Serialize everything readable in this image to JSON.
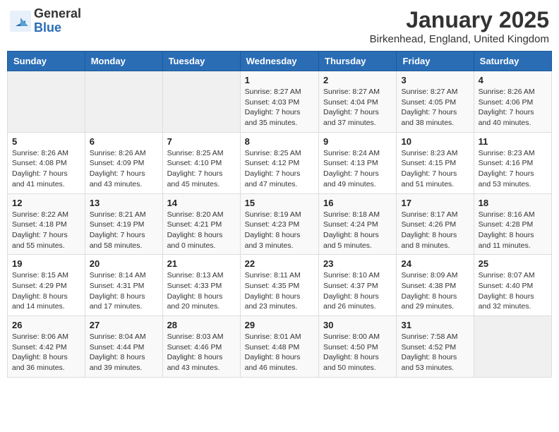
{
  "logo": {
    "general": "General",
    "blue": "Blue"
  },
  "title": "January 2025",
  "location": "Birkenhead, England, United Kingdom",
  "weekdays": [
    "Sunday",
    "Monday",
    "Tuesday",
    "Wednesday",
    "Thursday",
    "Friday",
    "Saturday"
  ],
  "weeks": [
    [
      {
        "day": "",
        "sunrise": "",
        "sunset": "",
        "daylight": ""
      },
      {
        "day": "",
        "sunrise": "",
        "sunset": "",
        "daylight": ""
      },
      {
        "day": "",
        "sunrise": "",
        "sunset": "",
        "daylight": ""
      },
      {
        "day": "1",
        "sunrise": "Sunrise: 8:27 AM",
        "sunset": "Sunset: 4:03 PM",
        "daylight": "Daylight: 7 hours and 35 minutes."
      },
      {
        "day": "2",
        "sunrise": "Sunrise: 8:27 AM",
        "sunset": "Sunset: 4:04 PM",
        "daylight": "Daylight: 7 hours and 37 minutes."
      },
      {
        "day": "3",
        "sunrise": "Sunrise: 8:27 AM",
        "sunset": "Sunset: 4:05 PM",
        "daylight": "Daylight: 7 hours and 38 minutes."
      },
      {
        "day": "4",
        "sunrise": "Sunrise: 8:26 AM",
        "sunset": "Sunset: 4:06 PM",
        "daylight": "Daylight: 7 hours and 40 minutes."
      }
    ],
    [
      {
        "day": "5",
        "sunrise": "Sunrise: 8:26 AM",
        "sunset": "Sunset: 4:08 PM",
        "daylight": "Daylight: 7 hours and 41 minutes."
      },
      {
        "day": "6",
        "sunrise": "Sunrise: 8:26 AM",
        "sunset": "Sunset: 4:09 PM",
        "daylight": "Daylight: 7 hours and 43 minutes."
      },
      {
        "day": "7",
        "sunrise": "Sunrise: 8:25 AM",
        "sunset": "Sunset: 4:10 PM",
        "daylight": "Daylight: 7 hours and 45 minutes."
      },
      {
        "day": "8",
        "sunrise": "Sunrise: 8:25 AM",
        "sunset": "Sunset: 4:12 PM",
        "daylight": "Daylight: 7 hours and 47 minutes."
      },
      {
        "day": "9",
        "sunrise": "Sunrise: 8:24 AM",
        "sunset": "Sunset: 4:13 PM",
        "daylight": "Daylight: 7 hours and 49 minutes."
      },
      {
        "day": "10",
        "sunrise": "Sunrise: 8:23 AM",
        "sunset": "Sunset: 4:15 PM",
        "daylight": "Daylight: 7 hours and 51 minutes."
      },
      {
        "day": "11",
        "sunrise": "Sunrise: 8:23 AM",
        "sunset": "Sunset: 4:16 PM",
        "daylight": "Daylight: 7 hours and 53 minutes."
      }
    ],
    [
      {
        "day": "12",
        "sunrise": "Sunrise: 8:22 AM",
        "sunset": "Sunset: 4:18 PM",
        "daylight": "Daylight: 7 hours and 55 minutes."
      },
      {
        "day": "13",
        "sunrise": "Sunrise: 8:21 AM",
        "sunset": "Sunset: 4:19 PM",
        "daylight": "Daylight: 7 hours and 58 minutes."
      },
      {
        "day": "14",
        "sunrise": "Sunrise: 8:20 AM",
        "sunset": "Sunset: 4:21 PM",
        "daylight": "Daylight: 8 hours and 0 minutes."
      },
      {
        "day": "15",
        "sunrise": "Sunrise: 8:19 AM",
        "sunset": "Sunset: 4:23 PM",
        "daylight": "Daylight: 8 hours and 3 minutes."
      },
      {
        "day": "16",
        "sunrise": "Sunrise: 8:18 AM",
        "sunset": "Sunset: 4:24 PM",
        "daylight": "Daylight: 8 hours and 5 minutes."
      },
      {
        "day": "17",
        "sunrise": "Sunrise: 8:17 AM",
        "sunset": "Sunset: 4:26 PM",
        "daylight": "Daylight: 8 hours and 8 minutes."
      },
      {
        "day": "18",
        "sunrise": "Sunrise: 8:16 AM",
        "sunset": "Sunset: 4:28 PM",
        "daylight": "Daylight: 8 hours and 11 minutes."
      }
    ],
    [
      {
        "day": "19",
        "sunrise": "Sunrise: 8:15 AM",
        "sunset": "Sunset: 4:29 PM",
        "daylight": "Daylight: 8 hours and 14 minutes."
      },
      {
        "day": "20",
        "sunrise": "Sunrise: 8:14 AM",
        "sunset": "Sunset: 4:31 PM",
        "daylight": "Daylight: 8 hours and 17 minutes."
      },
      {
        "day": "21",
        "sunrise": "Sunrise: 8:13 AM",
        "sunset": "Sunset: 4:33 PM",
        "daylight": "Daylight: 8 hours and 20 minutes."
      },
      {
        "day": "22",
        "sunrise": "Sunrise: 8:11 AM",
        "sunset": "Sunset: 4:35 PM",
        "daylight": "Daylight: 8 hours and 23 minutes."
      },
      {
        "day": "23",
        "sunrise": "Sunrise: 8:10 AM",
        "sunset": "Sunset: 4:37 PM",
        "daylight": "Daylight: 8 hours and 26 minutes."
      },
      {
        "day": "24",
        "sunrise": "Sunrise: 8:09 AM",
        "sunset": "Sunset: 4:38 PM",
        "daylight": "Daylight: 8 hours and 29 minutes."
      },
      {
        "day": "25",
        "sunrise": "Sunrise: 8:07 AM",
        "sunset": "Sunset: 4:40 PM",
        "daylight": "Daylight: 8 hours and 32 minutes."
      }
    ],
    [
      {
        "day": "26",
        "sunrise": "Sunrise: 8:06 AM",
        "sunset": "Sunset: 4:42 PM",
        "daylight": "Daylight: 8 hours and 36 minutes."
      },
      {
        "day": "27",
        "sunrise": "Sunrise: 8:04 AM",
        "sunset": "Sunset: 4:44 PM",
        "daylight": "Daylight: 8 hours and 39 minutes."
      },
      {
        "day": "28",
        "sunrise": "Sunrise: 8:03 AM",
        "sunset": "Sunset: 4:46 PM",
        "daylight": "Daylight: 8 hours and 43 minutes."
      },
      {
        "day": "29",
        "sunrise": "Sunrise: 8:01 AM",
        "sunset": "Sunset: 4:48 PM",
        "daylight": "Daylight: 8 hours and 46 minutes."
      },
      {
        "day": "30",
        "sunrise": "Sunrise: 8:00 AM",
        "sunset": "Sunset: 4:50 PM",
        "daylight": "Daylight: 8 hours and 50 minutes."
      },
      {
        "day": "31",
        "sunrise": "Sunrise: 7:58 AM",
        "sunset": "Sunset: 4:52 PM",
        "daylight": "Daylight: 8 hours and 53 minutes."
      },
      {
        "day": "",
        "sunrise": "",
        "sunset": "",
        "daylight": ""
      }
    ]
  ]
}
